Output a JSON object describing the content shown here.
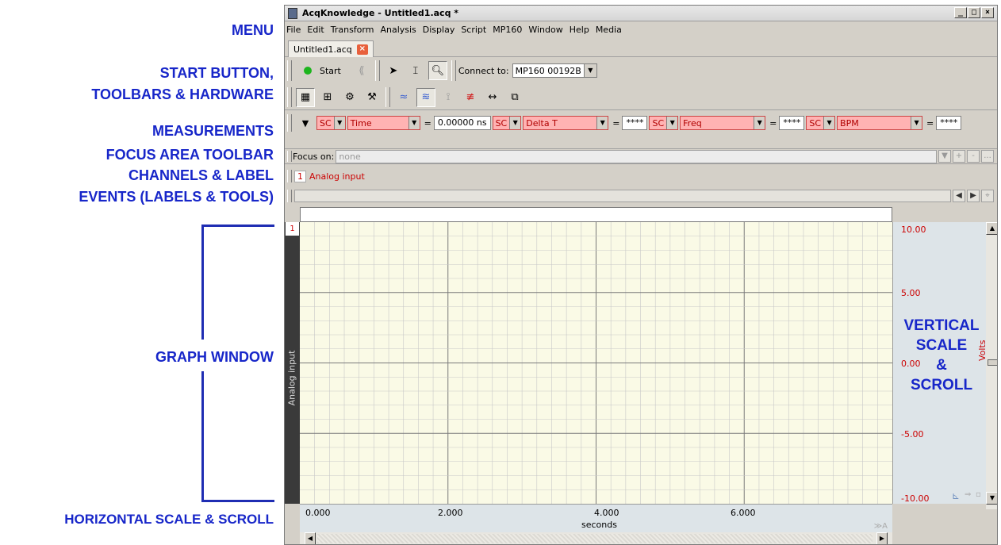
{
  "annotations": {
    "menu": "MENU",
    "start_button": "START BUTTON,",
    "toolbars_hardware": "TOOLBARS & HARDWARE",
    "measurements": "MEASUREMENTS",
    "focus_area": "FOCUS AREA TOOLBAR",
    "channels_label": "CHANNELS & LABEL",
    "events": "EVENTS (LABELS & TOOLS)",
    "graph_window": "GRAPH WINDOW",
    "horizontal_scale": "HORIZONTAL SCALE & SCROLL",
    "vertical_scale": [
      "VERTICAL",
      "SCALE",
      "&",
      "SCROLL"
    ]
  },
  "window": {
    "title": "AcqKnowledge - Untitled1.acq *",
    "controls": [
      "_",
      "□",
      "×"
    ]
  },
  "menu": [
    "File",
    "Edit",
    "Transform",
    "Analysis",
    "Display",
    "Script",
    "MP160",
    "Window",
    "Help",
    "Media"
  ],
  "tab": {
    "label": "Untitled1.acq",
    "close": "×"
  },
  "toolbar": {
    "start_label": "Start",
    "connect_label": "Connect to:",
    "connect_value": "MP160 00192B"
  },
  "measurements": [
    {
      "source": "SC",
      "type": "Time",
      "value": "0.00000 ns"
    },
    {
      "source": "SC",
      "type": "Delta T",
      "value": "****"
    },
    {
      "source": "SC",
      "type": "Freq",
      "value": "****"
    },
    {
      "source": "SC",
      "type": "BPM",
      "value": "****"
    }
  ],
  "focus": {
    "label": "Focus on:",
    "value": "none",
    "buttons": [
      "+",
      "-",
      "..."
    ]
  },
  "channel": {
    "number": "1",
    "name": "Analog input"
  },
  "graph": {
    "channel_number": "1",
    "channel_label": "Analog input",
    "y_ticks": [
      "10.00",
      "5.00",
      "0.00",
      "-5.00",
      "-10.00"
    ],
    "y_unit": "Volts",
    "x_ticks": [
      "0.000",
      "2.000",
      "4.000",
      "6.000"
    ],
    "x_unit": "seconds",
    "bg_color": "#fafae6",
    "grid_color": "#c8c8c8"
  }
}
